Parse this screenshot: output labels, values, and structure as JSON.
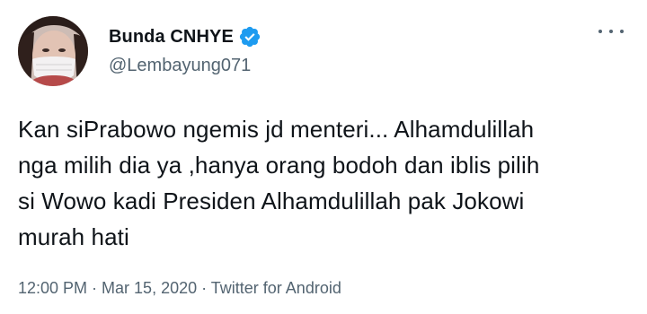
{
  "tweet": {
    "display_name": "Bunda CNHYE",
    "handle": "@Lembayung071",
    "verified": true,
    "text": "Kan siPrabowo ngemis jd menteri... Alhamdulillah\nnga milih dia ya ,hanya orang bodoh dan iblis pilih\nsi Wowo kadi Presiden Alhamdulillah pak Jokowi\nmurah hati",
    "meta": "12:00 PM · Mar 15, 2020 · Twitter for Android"
  },
  "icons": {
    "verified": "verified-badge-icon",
    "more": "more-options-icon"
  },
  "colors": {
    "verified_blue": "#1d9bf0",
    "secondary_text": "#536471",
    "primary_text": "#0f1419"
  }
}
